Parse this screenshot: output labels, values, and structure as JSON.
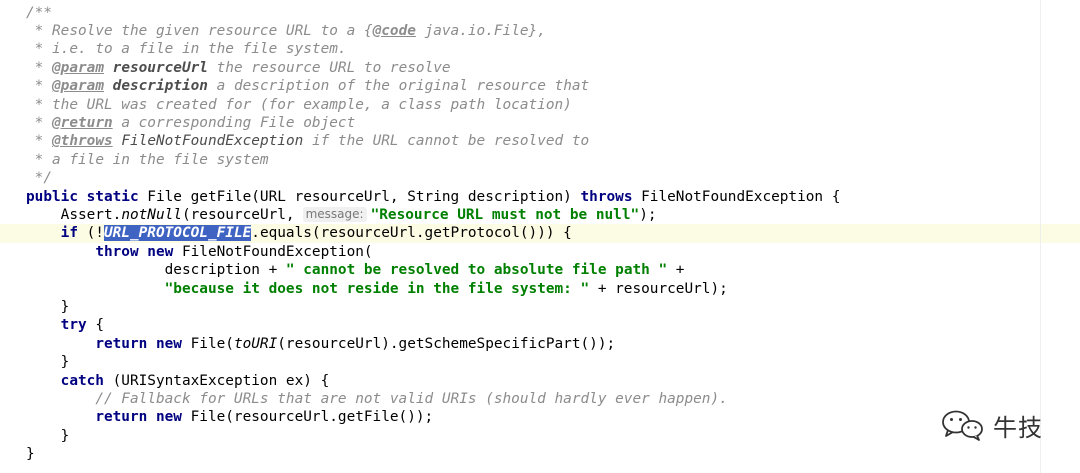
{
  "editor": {
    "language": "java",
    "highlight_color": "#fcfbe4",
    "selection_color": "#3f63c2",
    "lines": [
      {
        "indent": "",
        "segments": [
          {
            "t": "/**",
            "c": "doc"
          }
        ]
      },
      {
        "indent": " ",
        "segments": [
          {
            "t": "* Resolve the given resource URL to a {",
            "c": "doc"
          },
          {
            "t": "@code",
            "c": "doc-tag"
          },
          {
            "t": " java.io.File},",
            "c": "doc"
          }
        ]
      },
      {
        "indent": " ",
        "segments": [
          {
            "t": "* i.e. to a file in the file system.",
            "c": "doc"
          }
        ]
      },
      {
        "indent": " ",
        "segments": [
          {
            "t": "* ",
            "c": "doc"
          },
          {
            "t": "@param",
            "c": "doc-tag"
          },
          {
            "t": " ",
            "c": "doc"
          },
          {
            "t": "resourceUrl",
            "c": "doc-param"
          },
          {
            "t": " the resource URL to resolve",
            "c": "doc"
          }
        ]
      },
      {
        "indent": " ",
        "segments": [
          {
            "t": "* ",
            "c": "doc"
          },
          {
            "t": "@param",
            "c": "doc-tag"
          },
          {
            "t": " ",
            "c": "doc"
          },
          {
            "t": "description",
            "c": "doc-param"
          },
          {
            "t": " a description of the original resource that",
            "c": "doc"
          }
        ]
      },
      {
        "indent": " ",
        "segments": [
          {
            "t": "* the URL was created for (for example, a class path location)",
            "c": "doc"
          }
        ]
      },
      {
        "indent": " ",
        "segments": [
          {
            "t": "* ",
            "c": "doc"
          },
          {
            "t": "@return",
            "c": "doc-tag"
          },
          {
            "t": " a corresponding File object",
            "c": "doc"
          }
        ]
      },
      {
        "indent": " ",
        "segments": [
          {
            "t": "* ",
            "c": "doc"
          },
          {
            "t": "@throws",
            "c": "doc-tag"
          },
          {
            "t": " ",
            "c": "doc"
          },
          {
            "t": "FileNotFoundException",
            "c": "doc-throws"
          },
          {
            "t": " if the URL cannot be resolved to",
            "c": "doc"
          }
        ]
      },
      {
        "indent": " ",
        "segments": [
          {
            "t": "* a file in the file system",
            "c": "doc"
          }
        ]
      },
      {
        "indent": " ",
        "segments": [
          {
            "t": "*/",
            "c": "doc"
          }
        ]
      },
      {
        "indent": "",
        "segments": [
          {
            "t": "public static",
            "c": "kw"
          },
          {
            "t": " File getFile(URL resourceUrl, String description) ",
            "c": ""
          },
          {
            "t": "throws",
            "c": "kw"
          },
          {
            "t": " FileNotFoundException {",
            "c": ""
          }
        ]
      },
      {
        "indent": "    ",
        "segments": [
          {
            "t": "Assert.",
            "c": ""
          },
          {
            "t": "notNull",
            "c": "static-call"
          },
          {
            "t": "(resourceUrl,",
            "c": ""
          },
          {
            "t": "message:",
            "c": "hint"
          },
          {
            "t": "\"Resource URL must not be null\"",
            "c": "str"
          },
          {
            "t": ");",
            "c": ""
          }
        ]
      },
      {
        "indent": "    ",
        "current": true,
        "segments": [
          {
            "t": "if",
            "c": "kw"
          },
          {
            "t": " (!",
            "c": ""
          },
          {
            "t": "URL_PROTOCOL_FILE",
            "c": "const-sel"
          },
          {
            "t": ".equals(resourceUrl.getProtocol())) {",
            "c": ""
          }
        ]
      },
      {
        "indent": "        ",
        "segments": [
          {
            "t": "throw new",
            "c": "kw"
          },
          {
            "t": " FileNotFoundException(",
            "c": ""
          }
        ]
      },
      {
        "indent": "                ",
        "segments": [
          {
            "t": "description + ",
            "c": ""
          },
          {
            "t": "\" cannot be resolved to absolute file path \"",
            "c": "str"
          },
          {
            "t": " +",
            "c": ""
          }
        ]
      },
      {
        "indent": "                ",
        "segments": [
          {
            "t": "\"because it does not reside in the file system: \"",
            "c": "str"
          },
          {
            "t": " + resourceUrl);",
            "c": ""
          }
        ]
      },
      {
        "indent": "    ",
        "segments": [
          {
            "t": "}",
            "c": ""
          }
        ]
      },
      {
        "indent": "    ",
        "segments": [
          {
            "t": "try",
            "c": "kw"
          },
          {
            "t": " {",
            "c": ""
          }
        ]
      },
      {
        "indent": "        ",
        "segments": [
          {
            "t": "return new",
            "c": "kw"
          },
          {
            "t": " File(",
            "c": ""
          },
          {
            "t": "toURI",
            "c": "static-call"
          },
          {
            "t": "(resourceUrl).getSchemeSpecificPart());",
            "c": ""
          }
        ]
      },
      {
        "indent": "    ",
        "segments": [
          {
            "t": "}",
            "c": ""
          }
        ]
      },
      {
        "indent": "    ",
        "segments": [
          {
            "t": "catch",
            "c": "kw"
          },
          {
            "t": " (URISyntaxException ex) {",
            "c": ""
          }
        ]
      },
      {
        "indent": "        ",
        "segments": [
          {
            "t": "// Fallback for URLs that are not valid URIs (should hardly ever happen).",
            "c": "doc"
          }
        ]
      },
      {
        "indent": "        ",
        "segments": [
          {
            "t": "return new",
            "c": "kw"
          },
          {
            "t": " File(resourceUrl.getFile());",
            "c": ""
          }
        ]
      },
      {
        "indent": "    ",
        "segments": [
          {
            "t": "}",
            "c": ""
          }
        ]
      },
      {
        "indent": "",
        "segments": [
          {
            "t": "}",
            "c": ""
          }
        ]
      }
    ]
  },
  "watermark": {
    "text": "牛技",
    "icon": "wechat-icon",
    "color": "#333333"
  }
}
